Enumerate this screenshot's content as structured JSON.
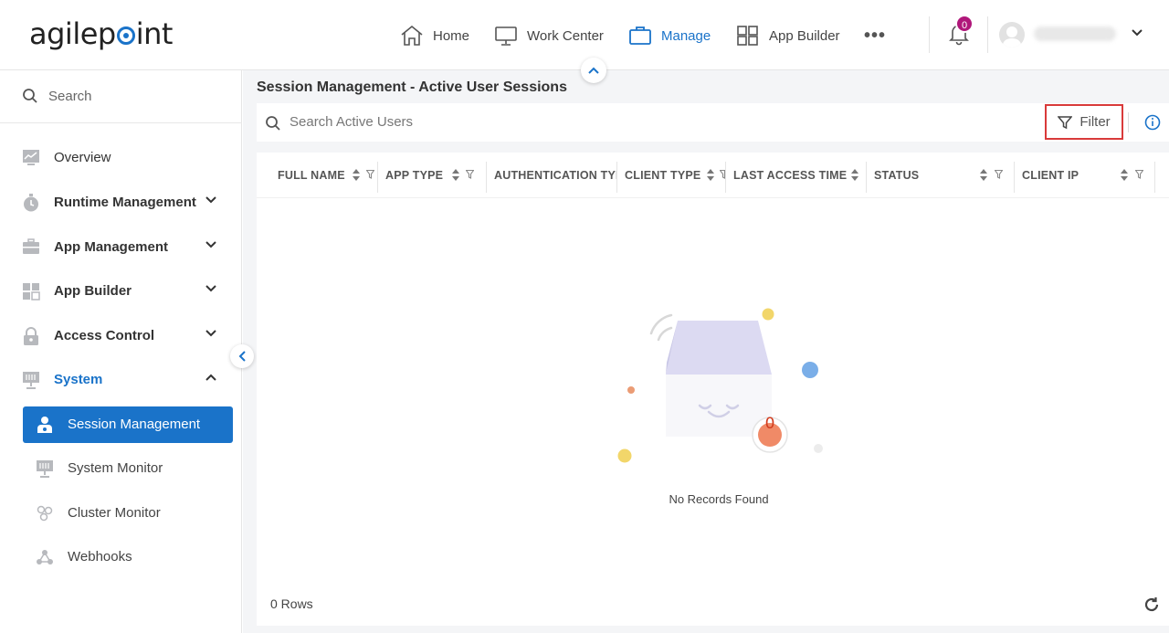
{
  "header": {
    "logo": {
      "pre": "agilep",
      "post": "int"
    },
    "nav": [
      {
        "label": "Home",
        "icon": "home-icon"
      },
      {
        "label": "Work Center",
        "icon": "monitor-icon"
      },
      {
        "label": "Manage",
        "icon": "briefcase-icon",
        "active": true
      },
      {
        "label": "App Builder",
        "icon": "grid-icon"
      }
    ],
    "more_label": "•••",
    "notifications_count": "0",
    "accent_color": "#1a73c9",
    "badge_color": "#b0177a"
  },
  "sidebar": {
    "search_placeholder": "Search",
    "items": [
      {
        "label": "Overview",
        "icon": "chart-icon"
      },
      {
        "label": "Runtime Management",
        "icon": "stopwatch-icon",
        "expandable": true
      },
      {
        "label": "App Management",
        "icon": "toolbox-icon",
        "expandable": true
      },
      {
        "label": "App Builder",
        "icon": "grid-icon",
        "expandable": true
      },
      {
        "label": "Access Control",
        "icon": "lock-icon",
        "expandable": true
      },
      {
        "label": "System",
        "icon": "system-icon",
        "expanded": true
      }
    ],
    "subitems": [
      {
        "label": "Session Management",
        "icon": "user-session-icon",
        "active": true
      },
      {
        "label": "System Monitor",
        "icon": "system-monitor-icon"
      },
      {
        "label": "Cluster Monitor",
        "icon": "cluster-icon"
      },
      {
        "label": "Webhooks",
        "icon": "webhook-icon"
      }
    ]
  },
  "main": {
    "title": "Session Management - Active User Sessions",
    "search_placeholder": "Search Active Users",
    "filter_label": "Filter",
    "columns": [
      "FULL NAME",
      "APP TYPE",
      "AUTHENTICATION TYPE",
      "CLIENT TYPE",
      "LAST ACCESS TIME",
      "STATUS",
      "CLIENT IP"
    ],
    "empty_badge": "0",
    "empty_message": "No Records Found",
    "rows_label": "0 Rows"
  }
}
